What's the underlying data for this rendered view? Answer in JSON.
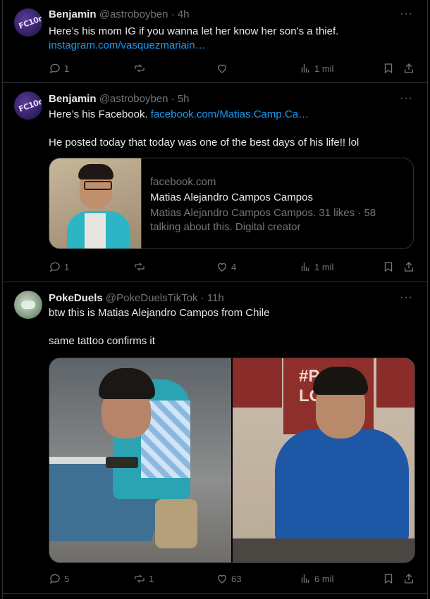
{
  "posts": [
    {
      "author": "Benjamin",
      "handle": "@astroboyben",
      "time": "4h",
      "line1": "Here’s his mom IG if you wanna let her know her son’s a thief.",
      "link": "instagram.com/vasquezmariain…",
      "replies": "1",
      "reposts": "",
      "likes": "",
      "views": "1 mil"
    },
    {
      "author": "Benjamin",
      "handle": "@astroboyben",
      "time": "5h",
      "line1_prefix": "Here’s his Facebook.",
      "link": "facebook.com/Matias.Camp.Ca…",
      "line2": "He posted today that today was one of the best days of his life!! lol",
      "card": {
        "domain": "facebook.com",
        "title": "Matias Alejandro Campos Campos",
        "desc_line1": "Matias Alejandro Campos Campos. 31 likes · 58",
        "desc_line2": "talking about this. Digital creator"
      },
      "replies": "1",
      "reposts": "",
      "likes": "4",
      "views": "1 mil"
    },
    {
      "author": "PokeDuels",
      "handle": "@PokeDuelsTikTok",
      "time": "11h",
      "line1": "btw this is Matias Alejandro Campos from Chile",
      "line2": "same tattoo confirms it",
      "replies": "5",
      "reposts": "1",
      "likes": "63",
      "views": "6 mil"
    }
  ],
  "avatar1_text": "FC10n",
  "sign_text": "#PO LOV",
  "colors": {
    "link": "#1d9bf0",
    "muted": "#71767b",
    "text": "#e7e9ea",
    "border": "#2f3336"
  }
}
